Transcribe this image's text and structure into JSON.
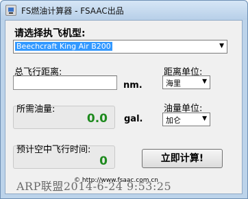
{
  "window": {
    "title": "FS燃油计算器 - FSAAC出品"
  },
  "aircraft": {
    "label": "请选择执飞机型:",
    "selected": "Beechcraft King Air B200"
  },
  "distance": {
    "label": "总飞行距离:",
    "value": "",
    "unit": "nm.",
    "unit_label": "距离单位:",
    "unit_selected": "海里"
  },
  "fuel": {
    "label": "所需油量:",
    "value": "0.0",
    "unit": "gal.",
    "unit_label": "油量单位:",
    "unit_selected": "加仑"
  },
  "flight_time": {
    "label": "预计空中飞行时间:",
    "value": "0"
  },
  "actions": {
    "calculate_label": "立即计算!"
  },
  "footer": {
    "copyright": "© http://www.fsaac.com.cn",
    "watermark": "ARP联盟2014-6-24 9:53:25"
  },
  "colors": {
    "result_green": "#1e8a1e",
    "selection_blue": "#3399ff",
    "frame_blue": "#bcd3ea"
  }
}
